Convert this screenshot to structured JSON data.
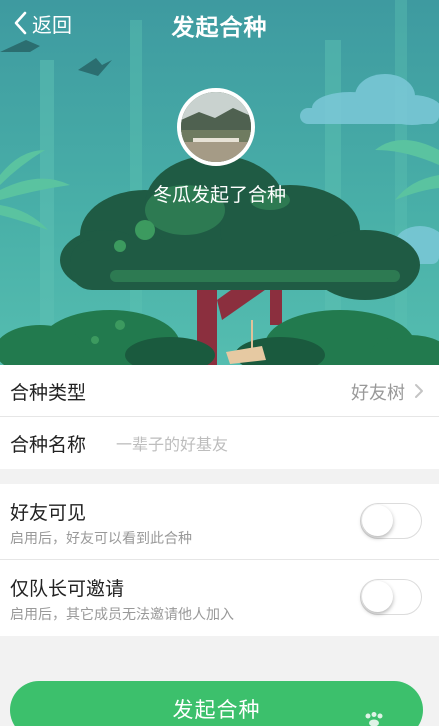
{
  "nav": {
    "back_label": "返回",
    "title": "发起合种"
  },
  "hero": {
    "starter_text": "冬瓜发起了合种"
  },
  "form": {
    "type": {
      "label": "合种类型",
      "value": "好友树"
    },
    "name": {
      "label": "合种名称",
      "placeholder": "一辈子的好基友",
      "value": ""
    }
  },
  "settings": {
    "friends_visible": {
      "title": "好友可见",
      "subtitle": "启用后，好友可以看到此合种",
      "enabled": false
    },
    "captain_invite_only": {
      "title": "仅队长可邀请",
      "subtitle": "启用后，其它成员无法邀请他人加入",
      "enabled": false
    }
  },
  "submit_label": "发起合种",
  "colors": {
    "sky": "#3fa7a3",
    "primary_button": "#3cc06c",
    "tree_dark": "#1f5b44",
    "trunk": "#8b2f3e"
  }
}
